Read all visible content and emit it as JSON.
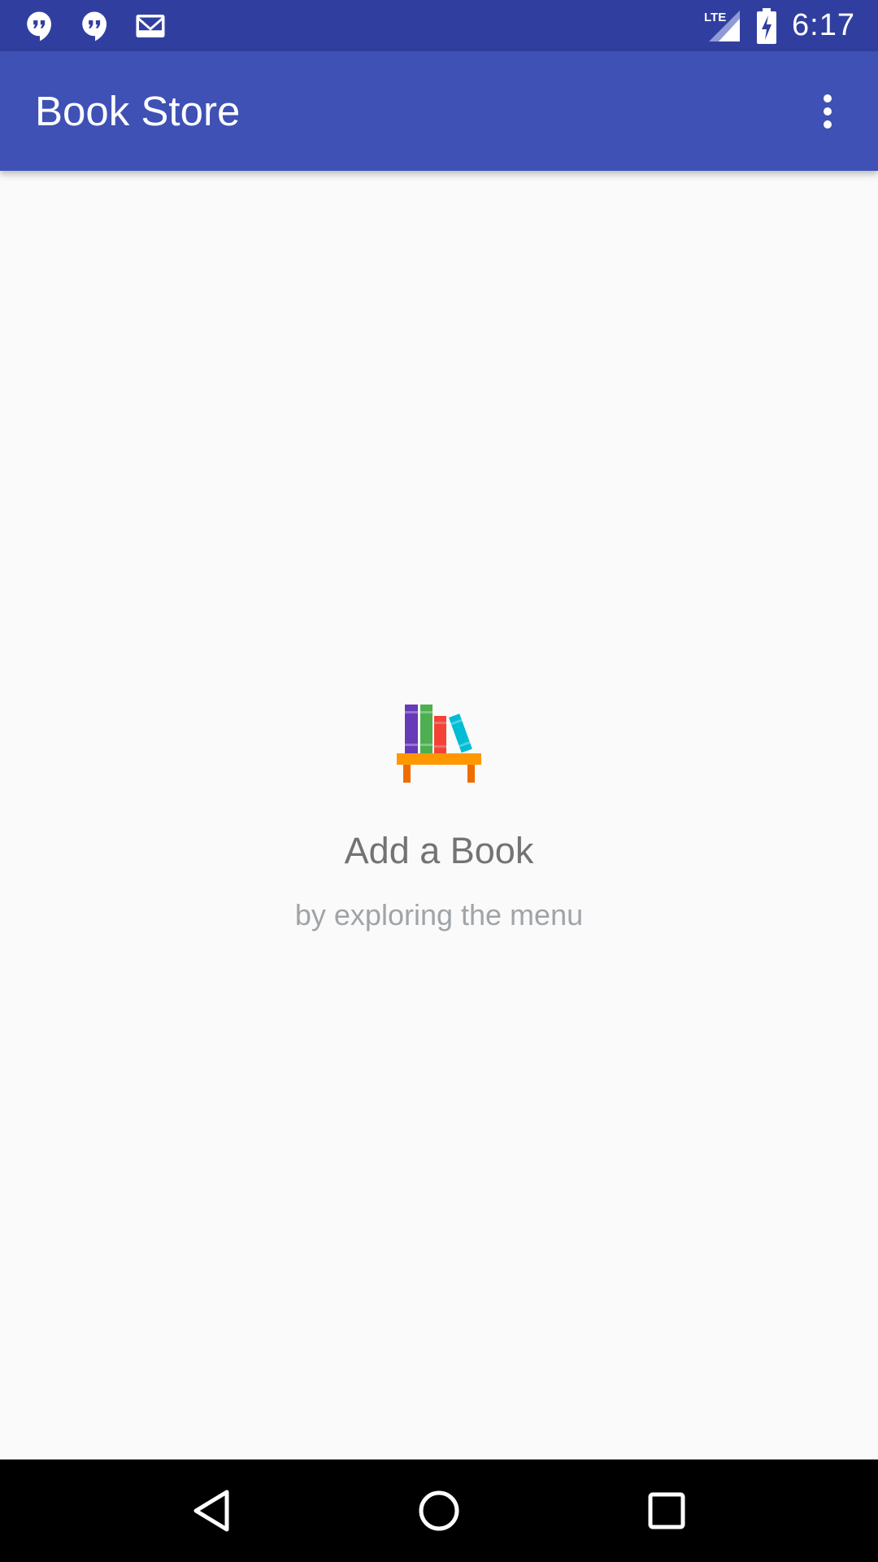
{
  "status_bar": {
    "time": "6:17",
    "network_label": "LTE",
    "left_icons": [
      "hangouts-icon",
      "hangouts-icon",
      "gmail-icon"
    ],
    "right_icons": [
      "signal-lte-icon",
      "battery-charging-icon"
    ]
  },
  "app_bar": {
    "title": "Book Store",
    "overflow_icon": "more-vert-icon"
  },
  "empty_state": {
    "icon": "bookshelf-icon",
    "title": "Add a Book",
    "subtitle": "by exploring the menu"
  },
  "nav_bar": {
    "buttons": [
      "back-icon",
      "home-icon",
      "recents-icon"
    ]
  },
  "colors": {
    "status_bar": "#303f9f",
    "app_bar": "#3f51b5",
    "background": "#fafafa",
    "title_text": "#737373",
    "subtitle_text": "#a0a4a8"
  }
}
